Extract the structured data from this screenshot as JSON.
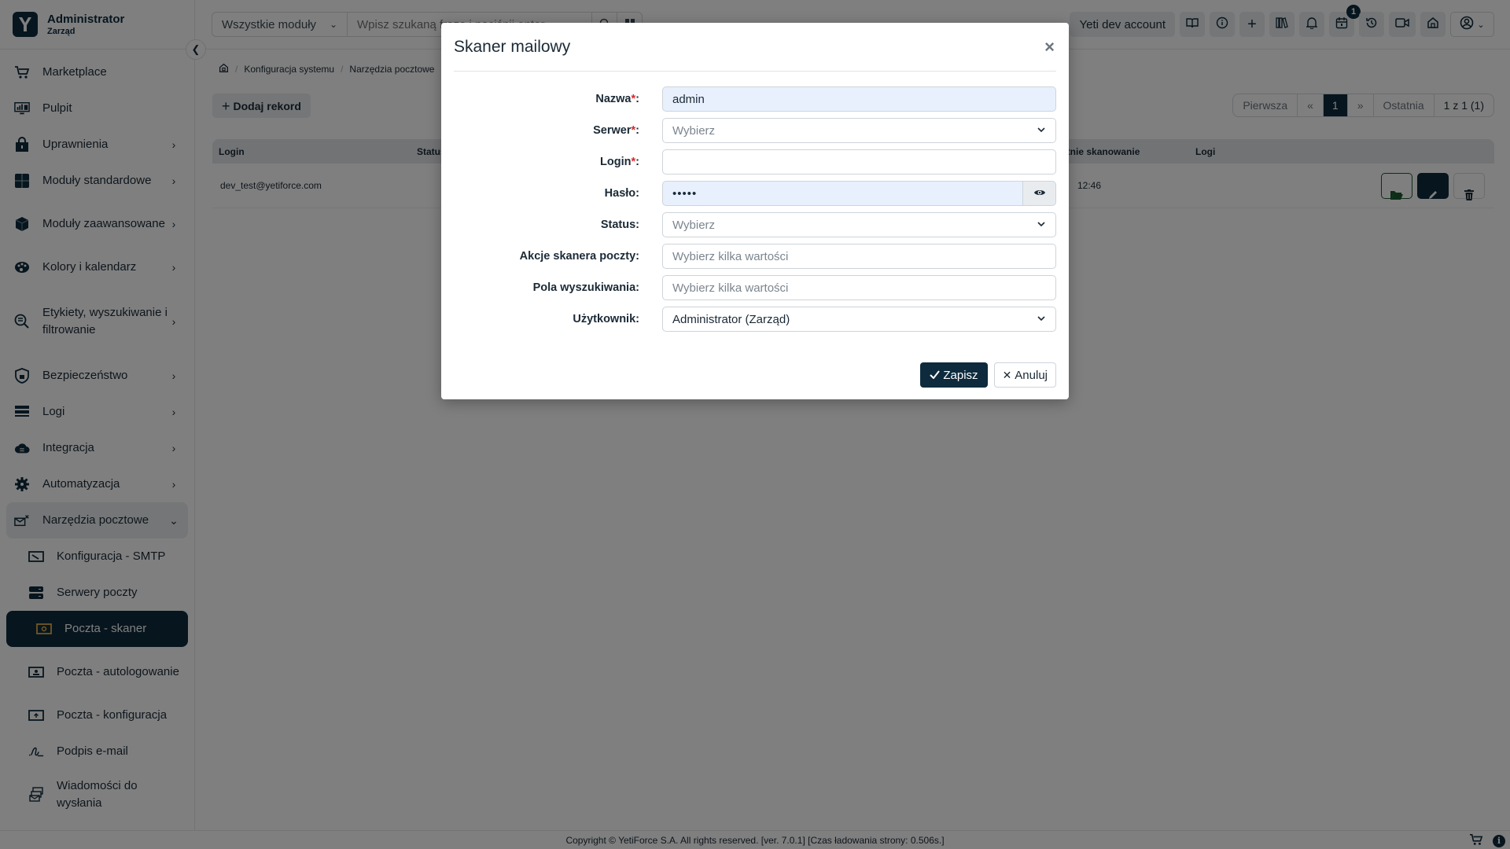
{
  "sidebar": {
    "user_name": "Administrator",
    "user_role": "Zarząd",
    "items": [
      {
        "label": "Marketplace"
      },
      {
        "label": "Pulpit"
      },
      {
        "label": "Uprawnienia"
      },
      {
        "label": "Moduły standardowe"
      },
      {
        "label": "Moduły zaawansowane"
      },
      {
        "label": "Kolory i kalendarz"
      },
      {
        "label": "Etykiety, wyszukiwanie i filtrowanie"
      },
      {
        "label": "Bezpieczeństwo"
      },
      {
        "label": "Logi"
      },
      {
        "label": "Integracja"
      },
      {
        "label": "Automatyzacja"
      },
      {
        "label": "Narzędzia pocztowe"
      }
    ],
    "subitems": [
      {
        "label": "Konfiguracja - SMTP"
      },
      {
        "label": "Serwery poczty"
      },
      {
        "label": "Poczta - skaner",
        "active": true
      },
      {
        "label": "Poczta - autologowanie"
      },
      {
        "label": "Poczta - konfiguracja"
      },
      {
        "label": "Podpis e-mail"
      },
      {
        "label": "Wiadomości do wysłania"
      }
    ]
  },
  "topbar": {
    "module_select": "Wszystkie moduły",
    "search_placeholder": "Wpisz szukaną frazę i naciśnij enter",
    "account_label": "Yeti dev account",
    "calendar_badge": "1"
  },
  "breadcrumb": {
    "items": [
      "Konfiguracja systemu",
      "Narzędzia pocztowe"
    ]
  },
  "main": {
    "add_button": "Dodaj rekord",
    "pager": {
      "first": "Pierwsza",
      "prev": "«",
      "current": "1",
      "next": "»",
      "last": "Ostatnia",
      "summary": "1 z 1 (1)"
    },
    "table": {
      "columns": [
        "Login",
        "Status",
        "Ostatnie skanowanie",
        "Logi"
      ],
      "rows": [
        {
          "login": "dev_test@yetiforce.com",
          "status": "",
          "last_scan": "12:46",
          "logs": ""
        }
      ]
    }
  },
  "modal": {
    "title": "Skaner mailowy",
    "close": "×",
    "fields": {
      "name": {
        "label": "Nazwa",
        "required": true,
        "value": "admin"
      },
      "server": {
        "label": "Serwer",
        "required": true,
        "placeholder": "Wybierz"
      },
      "login": {
        "label": "Login",
        "required": true,
        "value": ""
      },
      "password": {
        "label": "Hasło",
        "value": "•••••"
      },
      "status": {
        "label": "Status",
        "placeholder": "Wybierz"
      },
      "actions": {
        "label": "Akcje skanera poczty",
        "placeholder": "Wybierz kilka wartości"
      },
      "search_fields": {
        "label": "Pola wyszukiwania",
        "placeholder": "Wybierz kilka wartości"
      },
      "user": {
        "label": "Użytkownik",
        "value": "Administrator (Zarząd)"
      }
    },
    "save_label": "Zapisz",
    "cancel_label": "Anuluj"
  },
  "footer": {
    "text": "Copyright © YetiForce S.A. All rights reserved. [ver. 7.0.1] [Czas ładowania strony: 0.506s.]"
  },
  "colors": {
    "primary": "#0e2b3d",
    "required": "#e02424",
    "filled_input": "#e8f0fe",
    "folder_action": "#1d5b33"
  }
}
